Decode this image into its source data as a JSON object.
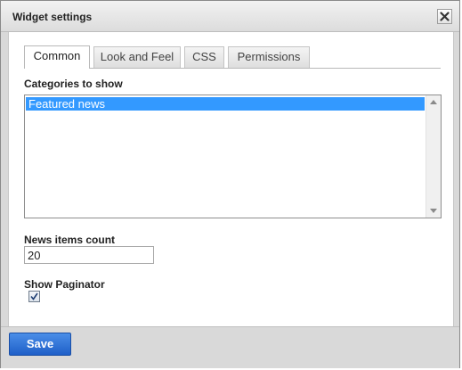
{
  "dialog": {
    "title": "Widget settings",
    "close_icon": "close-x-icon"
  },
  "tabs": [
    {
      "label": "Common",
      "active": true
    },
    {
      "label": "Look and Feel",
      "active": false
    },
    {
      "label": "CSS",
      "active": false
    },
    {
      "label": "Permissions",
      "active": false
    }
  ],
  "categories": {
    "label": "Categories to show",
    "items": [
      {
        "label": "Featured news",
        "selected": true
      }
    ]
  },
  "news_count": {
    "label": "News items count",
    "value": "20"
  },
  "paginator": {
    "label": "Show Paginator",
    "checked": true
  },
  "footer": {
    "save_label": "Save"
  },
  "colors": {
    "selection": "#3399ff",
    "save_button": "#2a6fd6"
  }
}
